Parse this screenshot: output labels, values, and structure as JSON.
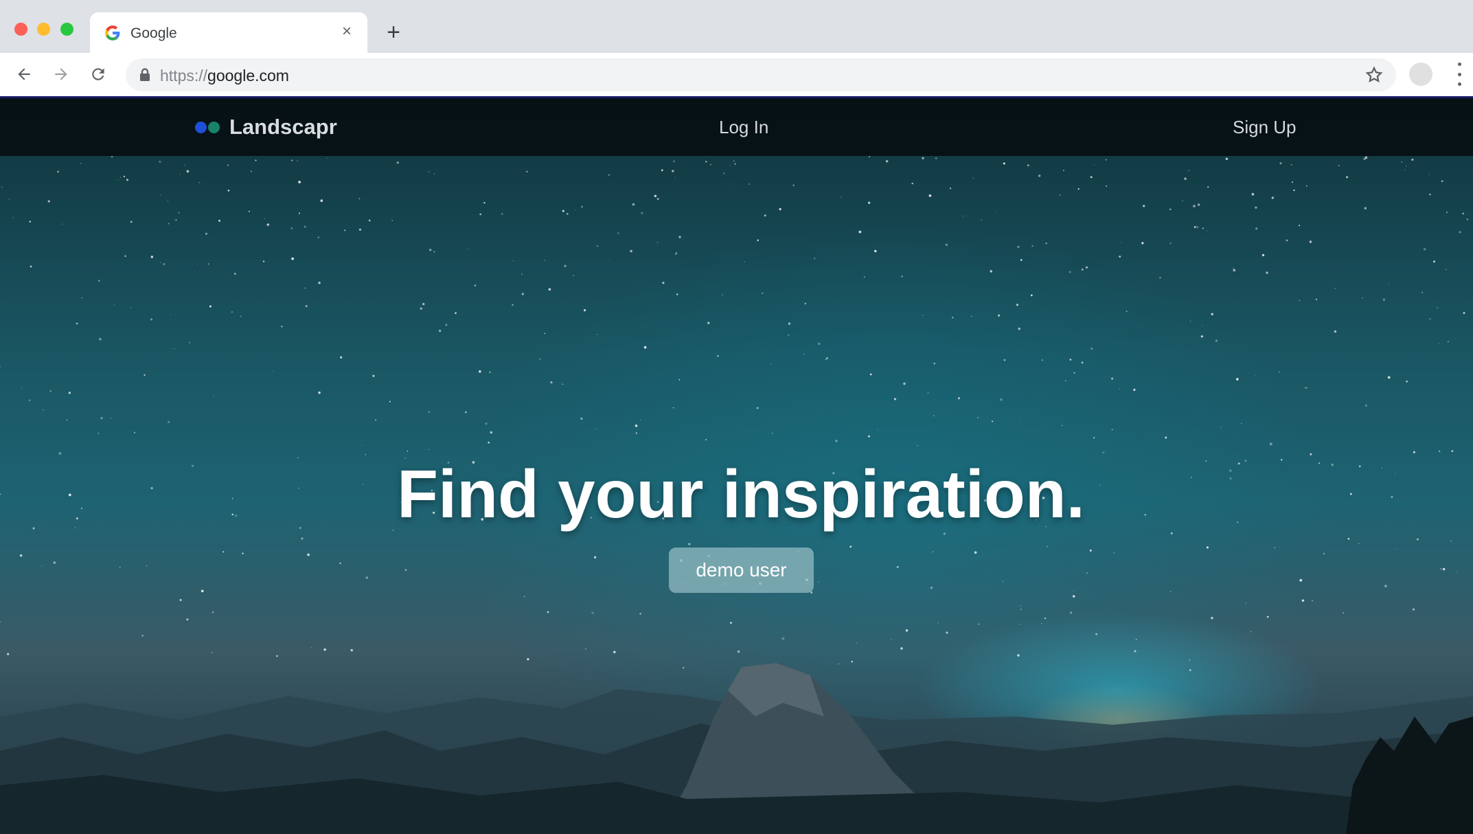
{
  "browser": {
    "tab_title": "Google",
    "close_glyph": "×",
    "new_tab_glyph": "+",
    "url_scheme": "https://",
    "url_host": "google.com"
  },
  "site": {
    "brand": "Landscapr",
    "nav": {
      "login_label": "Log In",
      "signup_label": "Sign Up"
    },
    "hero": {
      "title": "Find your inspiration.",
      "demo_button_label": "demo user"
    }
  },
  "colors": {
    "brand_dot_blue": "#1f4fd8",
    "brand_dot_green": "#18826a",
    "navbar_bg": "#050a0e",
    "sky_teal": "#1e6372"
  },
  "icons": [
    "google-g-icon",
    "close-icon",
    "plus-icon",
    "back-arrow-icon",
    "forward-arrow-icon",
    "reload-icon",
    "lock-icon",
    "star-icon",
    "kebab-menu-icon"
  ]
}
